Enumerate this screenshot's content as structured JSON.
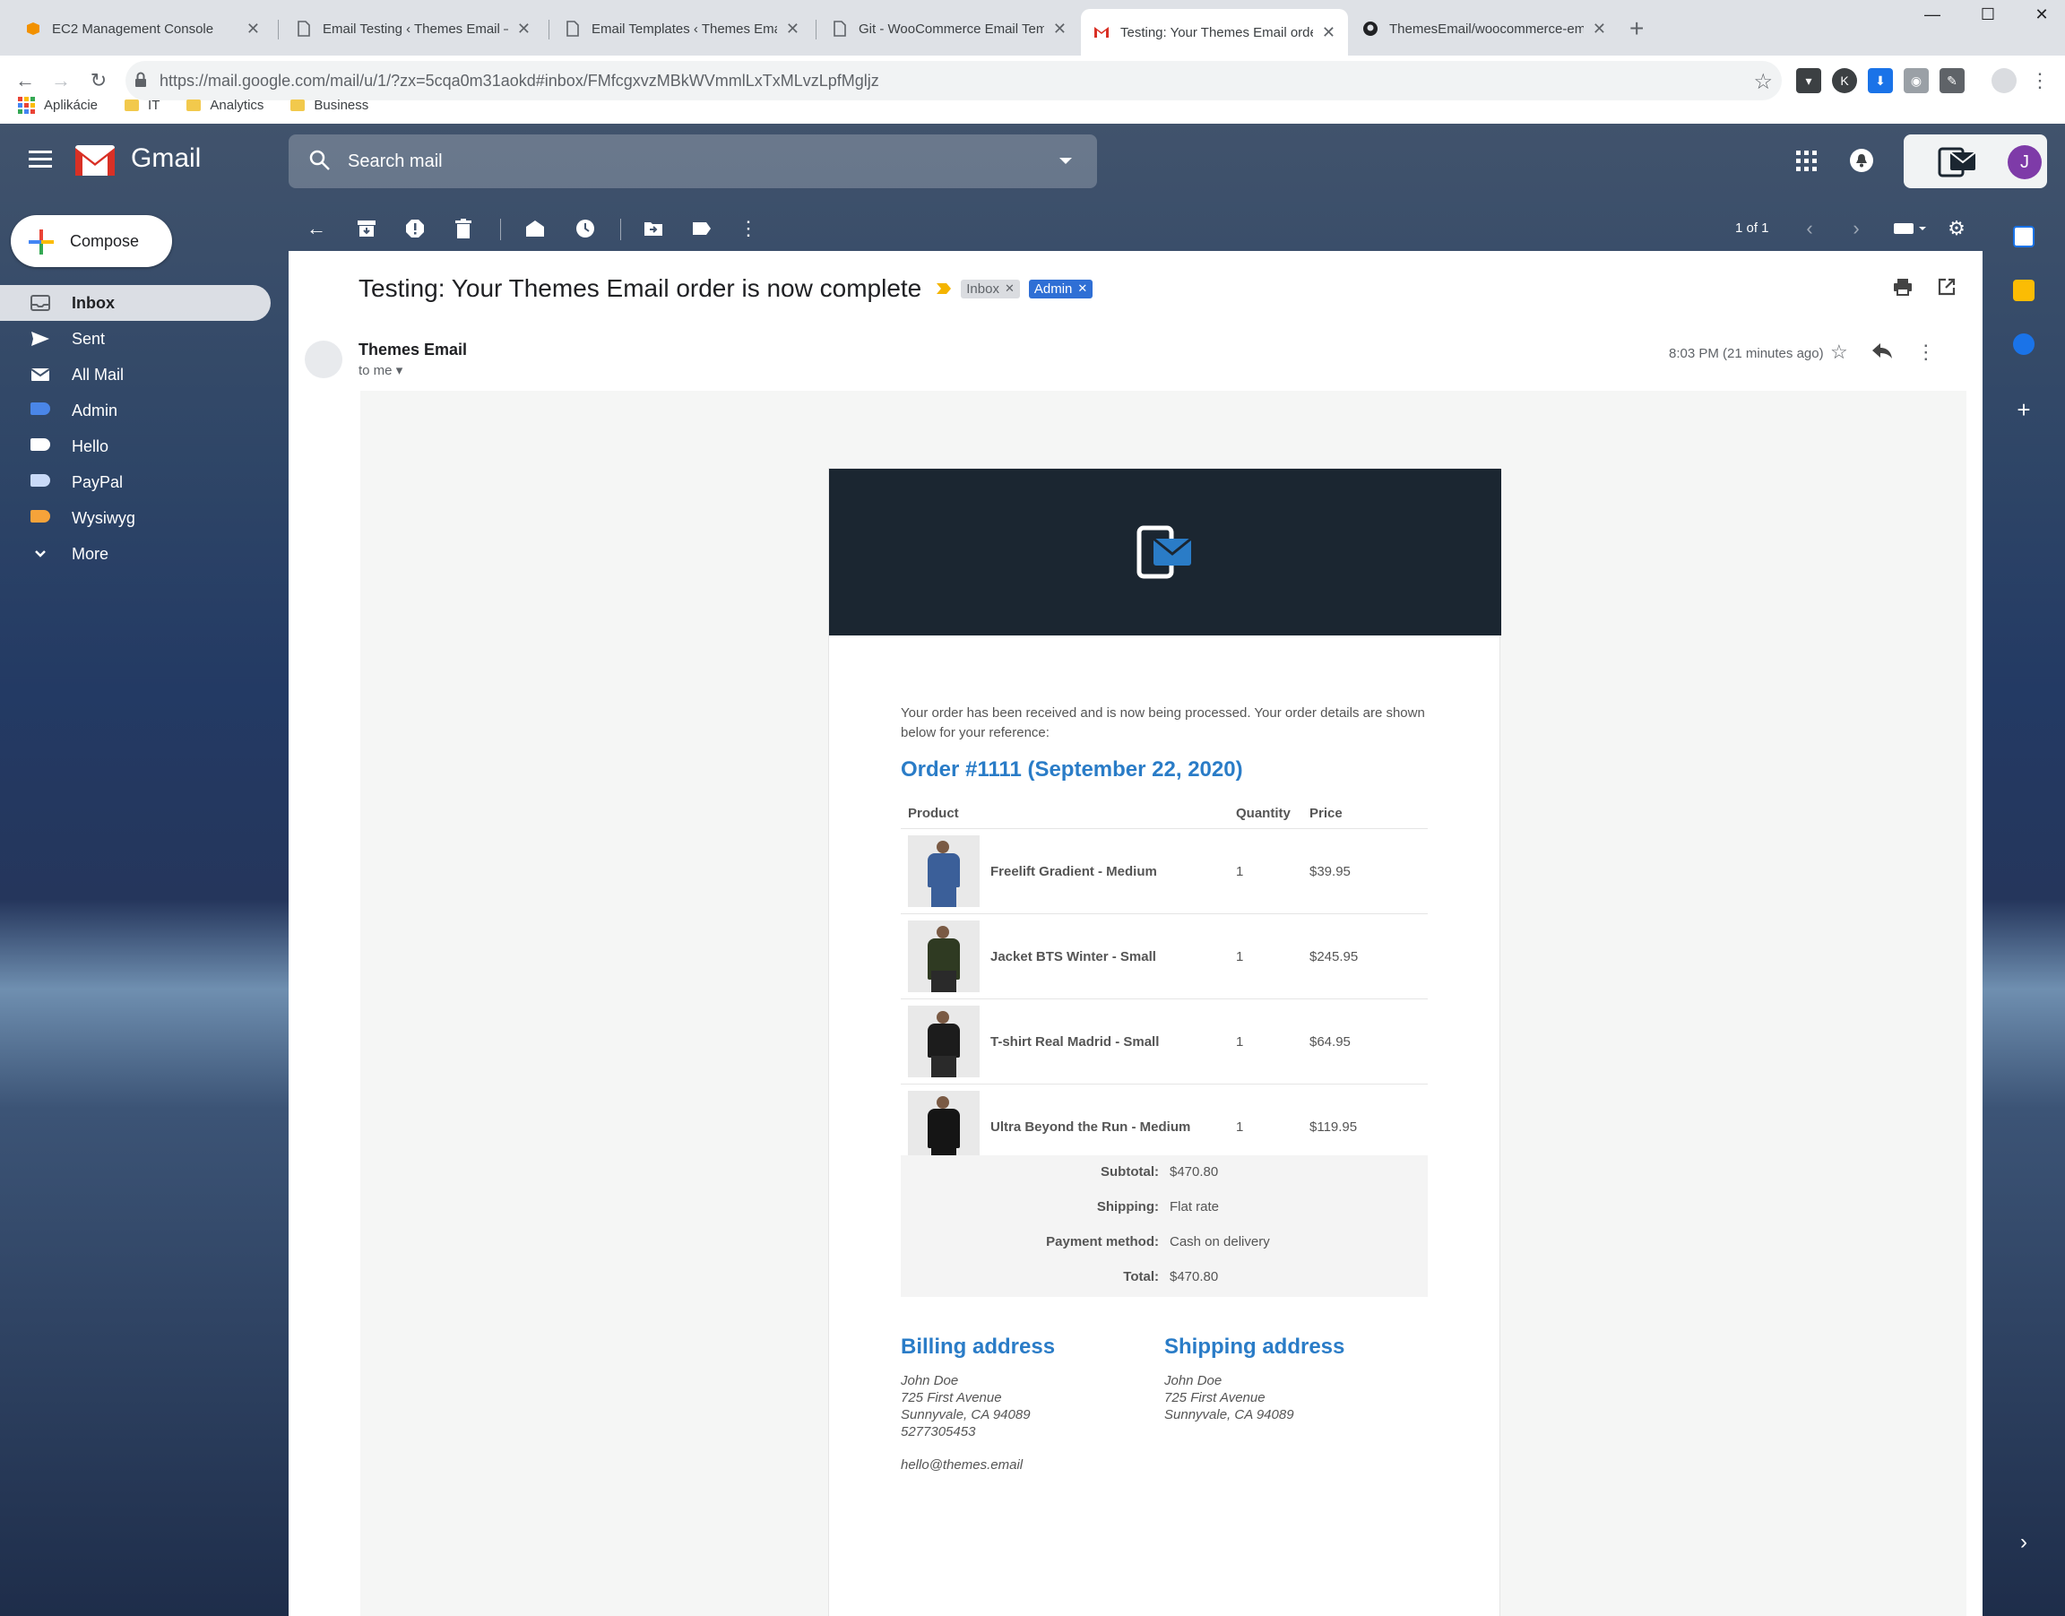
{
  "browser": {
    "tabs": [
      {
        "title": "EC2 Management Console",
        "icon": "aws-icon",
        "active": false
      },
      {
        "title": "Email Testing ‹ Themes Email — W",
        "icon": "page-icon",
        "active": false
      },
      {
        "title": "Email Templates ‹ Themes Email –",
        "icon": "page-icon",
        "active": false
      },
      {
        "title": "Git - WooCommerce Email Templ",
        "icon": "page-icon",
        "active": false
      },
      {
        "title": "Testing: Your Themes Email orde",
        "icon": "gmail-icon",
        "active": true
      },
      {
        "title": "ThemesEmail/woocommerce-em",
        "icon": "github-icon",
        "active": false
      }
    ],
    "url": "https://mail.google.com/mail/u/1/?zx=5cqa0m31aokd#inbox/FMfcgxvzMBkWVmmlLxTxMLvzLpfMgljz",
    "bookmarks": [
      "Aplikácie",
      "IT",
      "Analytics",
      "Business"
    ]
  },
  "gmail": {
    "app_name": "Gmail",
    "search_placeholder": "Search mail",
    "compose_label": "Compose",
    "avatar_letter": "J",
    "nav": [
      {
        "label": "Inbox",
        "icon": "inbox-icon",
        "active": true
      },
      {
        "label": "Sent",
        "icon": "send-icon",
        "active": false
      },
      {
        "label": "All Mail",
        "icon": "all-mail-icon",
        "active": false
      },
      {
        "label": "Admin",
        "icon": "label-icon",
        "color": "#4a86e8",
        "active": false
      },
      {
        "label": "Hello",
        "icon": "label-icon",
        "color": "#ffffff",
        "active": false
      },
      {
        "label": "PayPal",
        "icon": "label-icon",
        "color": "#c9daf8",
        "active": false
      },
      {
        "label": "Wysiwyg",
        "icon": "label-icon",
        "color": "#f6a33a",
        "active": false
      },
      {
        "label": "More",
        "icon": "chevron-down-icon",
        "active": false
      }
    ],
    "pager": "1 of 1"
  },
  "message": {
    "subject": "Testing: Your Themes Email order is now complete",
    "labels": [
      {
        "text": "Inbox",
        "color": "#dadce0"
      },
      {
        "text": "Admin",
        "color": "#2f6fd5"
      }
    ],
    "sender": "Themes Email",
    "to": "to me",
    "time": "8:03 PM (21 minutes ago)"
  },
  "email": {
    "intro": "Your order has been received and is now being processed. Your order details are shown below for your reference:",
    "order_title": "Order #1111 (September 22, 2020)",
    "columns": [
      "Product",
      "Quantity",
      "Price"
    ],
    "items": [
      {
        "name": "Freelift Gradient - Medium",
        "qty": "1",
        "price": "$39.95",
        "shirt_color": "#3b5f99"
      },
      {
        "name": "Jacket BTS Winter - Small",
        "qty": "1",
        "price": "$245.95",
        "shirt_color": "#2f3a22"
      },
      {
        "name": "T-shirt Real Madrid - Small",
        "qty": "1",
        "price": "$64.95",
        "shirt_color": "#1c1c1c"
      },
      {
        "name": "Ultra Beyond the Run - Medium",
        "qty": "1",
        "price": "$119.95",
        "shirt_color": "#151515"
      }
    ],
    "totals": [
      {
        "label": "Subtotal:",
        "value": "$470.80"
      },
      {
        "label": "Shipping:",
        "value": "Flat rate"
      },
      {
        "label": "Payment method:",
        "value": "Cash on delivery"
      },
      {
        "label": "Total:",
        "value": "$470.80"
      }
    ],
    "billing": {
      "title": "Billing address",
      "lines": [
        "John Doe",
        "725 First Avenue",
        "Sunnyvale, CA 94089",
        "5277305453"
      ],
      "email": "hello@themes.email"
    },
    "shipping": {
      "title": "Shipping address",
      "lines": [
        "John Doe",
        "725 First Avenue",
        "Sunnyvale, CA 94089"
      ]
    },
    "accent_color": "#2a7cc7",
    "header_color": "#1b2631"
  }
}
